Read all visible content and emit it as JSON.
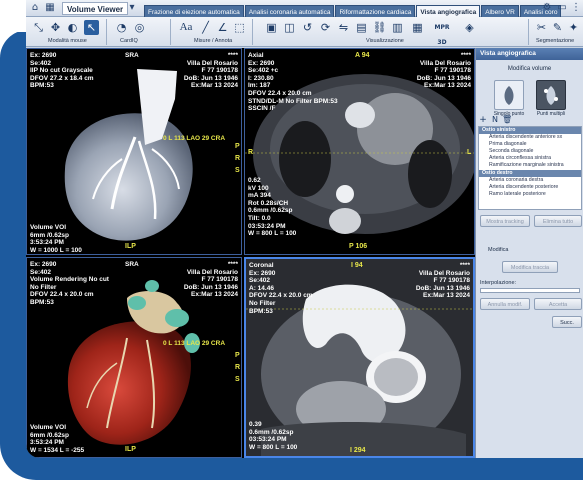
{
  "app": {
    "title": "Volume Viewer",
    "tabs": [
      "Frazione di eiezione automatica",
      "Analisi coronaria automatica",
      "Riformattazione cardiaca",
      "Vista angiografica",
      "Albero VR",
      "Analisi coro"
    ],
    "active_tab": "Vista angiografica",
    "mpr_label": "MPR 3D"
  },
  "toolbar": {
    "groups": [
      "Modalità mouse",
      "CardIQ",
      "Misure / Annota",
      "Visualizzazione",
      "Segmentazione"
    ],
    "text_tool": "Aa"
  },
  "viewports": {
    "tl": {
      "label": "SRA",
      "left": [
        "Ex: 2690",
        "Se:402",
        "IIP No cut Grayscale",
        "DFOV 27.2 x 18.4 cm",
        "BPM:53"
      ],
      "right": [
        "****",
        "Villa Del Rosario",
        "F 77 190178",
        "DoB: Jun 13 1946",
        "Ex:Mar 13 2024"
      ],
      "angle": "0 L 113 LAO 29 CRA",
      "prs": "P R S",
      "bottom_left": [
        "Volume VOI",
        "6mm /0.62sp",
        "3:53:24 PM",
        "W = 1000 L = 100"
      ],
      "bottom_right": "ILP"
    },
    "tr": {
      "label": "Axial",
      "label2": "A 94",
      "left": [
        "Ex: 2690",
        "Se:402 +c",
        "I: 230.80",
        "Im: 187",
        "DFOV 22.4 x 20.0 cm",
        "STND/DL-M  No Filter  BPM:53",
        "SSCIN /F"
      ],
      "right": [
        "****",
        "Villa Del Rosario",
        "F 77 190178",
        "DoB: Jun 13 1946",
        "Ex:Mar 13 2024"
      ],
      "lower_left": [
        "0.62",
        "kV 100",
        "mA 394",
        "Rot 0.28s/CH",
        "0.6mm /0.62sp",
        "Tilt: 0.0",
        "03:53:24 PM",
        "W = 800 L = 100"
      ],
      "bottom_center": "P 106",
      "side_left": "R",
      "side_right": "L"
    },
    "bl": {
      "label": "SRA",
      "left": [
        "Ex: 2690",
        "Se:402",
        "Volume Rendering No cut",
        "No Filter",
        "DFOV 22.4 x 20.0 cm",
        "BPM:53"
      ],
      "right": [
        "****",
        "Villa Del Rosario",
        "F 77 190178",
        "DoB: Jun 13 1946",
        "Ex:Mar 13 2024"
      ],
      "angle": "0 L 113 LAO 29 CRA",
      "prs": "P R S",
      "bottom_left": [
        "Volume VOI",
        "6mm /0.62sp",
        "3:53:24 PM",
        "W = 1534 L = -255"
      ],
      "bottom_right": "ILP"
    },
    "br": {
      "label": "Coronal",
      "label2": "I 94",
      "left": [
        "Ex: 2690",
        "Se:402",
        "A: 14.46",
        "DFOV 22.4 x 20.0 cm",
        "No Filter",
        "BPM:53"
      ],
      "right": [
        "****",
        "Villa Del Rosario",
        "F 77 190178",
        "DoB: Jun 13 1946",
        "Ex:Mar 13 2024"
      ],
      "lower_left": [
        "0.39",
        "0.6mm /0.62sp",
        "03:53:24 PM",
        "W = 800 L = 100"
      ],
      "bottom_center": "I 294"
    }
  },
  "panel": {
    "title": "Vista angiografica",
    "section": "Modifica volume",
    "mode_single": "Singolo punto",
    "mode_multi": "Punti multipli",
    "tree": [
      {
        "text": "Ostio sinistro",
        "group": true
      },
      {
        "text": "Arteria discendente anteriore sx",
        "group": false
      },
      {
        "text": "Prima diagonale",
        "group": false
      },
      {
        "text": "Seconda diagonale",
        "group": false
      },
      {
        "text": "Arteria circonflessa sinistra",
        "group": false
      },
      {
        "text": "Ramificazione marginale sinistra",
        "group": false
      },
      {
        "text": "Ostio destro",
        "group": true
      },
      {
        "text": "Arteria coronaria destra",
        "group": false
      },
      {
        "text": "Arteria discendente posteriore",
        "group": false
      },
      {
        "text": "Ramo laterale posteriore",
        "group": false
      }
    ],
    "show_tracking": "Mostra tracking",
    "delete_all": "Elimina tutto",
    "modify_label": "Modifica",
    "modify_track": "Modifica traccia",
    "interpolation_label": "Interpolazione:",
    "cancel_modify": "Annulla modif.",
    "accept": "Accetta",
    "next": "Succ."
  },
  "colors": {
    "frame": "#1d5a9e",
    "active_border": "#4a86e8",
    "overlay_yellow": "#e7e64a"
  }
}
